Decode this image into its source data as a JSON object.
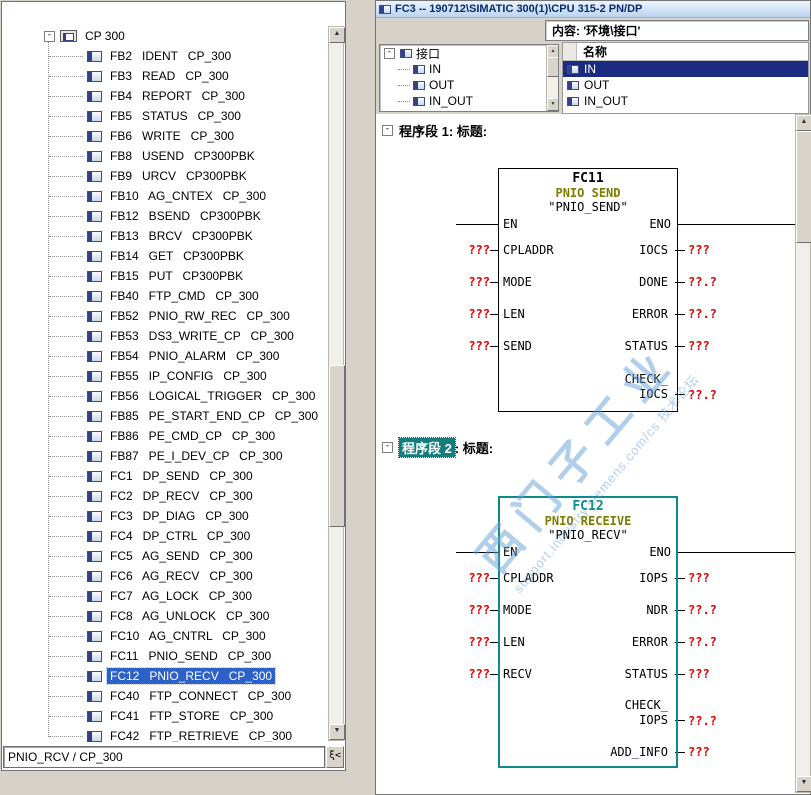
{
  "icons": {
    "minus": "-",
    "up": "▲",
    "down": "▼",
    "filter": "ξ<"
  },
  "left_panel": {
    "root_label": "CP 300",
    "items": [
      {
        "label": "FB2   IDENT   CP_300"
      },
      {
        "label": "FB3   READ   CP_300"
      },
      {
        "label": "FB4   REPORT   CP_300"
      },
      {
        "label": "FB5   STATUS   CP_300"
      },
      {
        "label": "FB6   WRITE   CP_300"
      },
      {
        "label": "FB8   USEND   CP300PBK"
      },
      {
        "label": "FB9   URCV   CP300PBK"
      },
      {
        "label": "FB10   AG_CNTEX   CP_300"
      },
      {
        "label": "FB12   BSEND   CP300PBK"
      },
      {
        "label": "FB13   BRCV   CP300PBK"
      },
      {
        "label": "FB14   GET   CP300PBK"
      },
      {
        "label": "FB15   PUT   CP300PBK"
      },
      {
        "label": "FB40   FTP_CMD   CP_300"
      },
      {
        "label": "FB52   PNIO_RW_REC   CP_300"
      },
      {
        "label": "FB53   DS3_WRITE_CP   CP_300"
      },
      {
        "label": "FB54   PNIO_ALARM   CP_300"
      },
      {
        "label": "FB55   IP_CONFIG   CP_300"
      },
      {
        "label": "FB56   LOGICAL_TRIGGER   CP_300"
      },
      {
        "label": "FB85   PE_START_END_CP   CP_300"
      },
      {
        "label": "FB86   PE_CMD_CP   CP_300"
      },
      {
        "label": "FB87   PE_I_DEV_CP   CP_300"
      },
      {
        "label": "FC1   DP_SEND   CP_300"
      },
      {
        "label": "FC2   DP_RECV   CP_300"
      },
      {
        "label": "FC3   DP_DIAG   CP_300"
      },
      {
        "label": "FC4   DP_CTRL   CP_300"
      },
      {
        "label": "FC5   AG_SEND   CP_300"
      },
      {
        "label": "FC6   AG_RECV   CP_300"
      },
      {
        "label": "FC7   AG_LOCK   CP_300"
      },
      {
        "label": "FC8   AG_UNLOCK   CP_300"
      },
      {
        "label": "FC10   AG_CNTRL   CP_300"
      },
      {
        "label": "FC11   PNIO_SEND   CP_300"
      },
      {
        "label": "FC12   PNIO_RECV   CP_300",
        "cls": "selected"
      },
      {
        "label": "FC40   FTP_CONNECT   CP_300"
      },
      {
        "label": "FC41   FTP_STORE   CP_300"
      },
      {
        "label": "FC42   FTP_RETRIEVE   CP_300"
      }
    ],
    "status_text": "PNIO_RCV / CP_300"
  },
  "right_panel": {
    "title": "FC3 -- 190712\\SIMATIC 300(1)\\CPU 315-2 PN/DP",
    "contents_label": "内容:  '环境\\接口'",
    "interface": {
      "root": "接口",
      "children": [
        {
          "label": "IN"
        },
        {
          "label": "OUT"
        },
        {
          "label": "IN_OUT"
        }
      ]
    },
    "table": {
      "header": "名称",
      "rows": [
        {
          "label": "IN",
          "cls": "selected"
        },
        {
          "label": "OUT"
        },
        {
          "label": "IN_OUT"
        }
      ]
    },
    "networks": [
      {
        "number_label": "程序段 1",
        "title_label": ": 标题:",
        "block": {
          "name": "FC11",
          "type": "PNIO SEND",
          "symbol": "\"PNIO_SEND\"",
          "rows": [
            {
              "l": "EN",
              "r": "ENO",
              "cls": "row-en"
            },
            {
              "l": "CPLADDR",
              "r": "IOCS",
              "lv": "???",
              "rv": "???",
              "cls": "row"
            },
            {
              "l": "MODE",
              "r": "DONE",
              "lv": "???",
              "rv": "??.?",
              "cls": "row"
            },
            {
              "l": "LEN",
              "r": "ERROR",
              "lv": "???",
              "rv": "??.?",
              "cls": "row"
            },
            {
              "l": "SEND",
              "r": "STATUS",
              "lv": "???",
              "rv": "???",
              "cls": "row"
            },
            {
              "l": "",
              "r": "CHECK_\nIOCS",
              "lv": "",
              "rv": "??.?",
              "cls": "row-tall no-l"
            }
          ]
        }
      },
      {
        "number_label": "程序段 2",
        "title_label": ": 标题:",
        "block": {
          "name": "FC12",
          "type": "PNIO RECEIVE",
          "symbol": "\"PNIO_RECV\"",
          "rows": [
            {
              "l": "EN",
              "r": "ENO",
              "cls": "row-en"
            },
            {
              "l": "CPLADDR",
              "r": "IOPS",
              "lv": "???",
              "rv": "???",
              "cls": "row"
            },
            {
              "l": "MODE",
              "r": "NDR",
              "lv": "???",
              "rv": "??.?",
              "cls": "row"
            },
            {
              "l": "LEN",
              "r": "ERROR",
              "lv": "???",
              "rv": "??.?",
              "cls": "row"
            },
            {
              "l": "RECV",
              "r": "STATUS",
              "lv": "???",
              "rv": "???",
              "cls": "row"
            },
            {
              "l": "",
              "r": "CHECK_\nIOPS",
              "lv": "",
              "rv": "??.?",
              "cls": "row-tall no-l"
            },
            {
              "l": "",
              "r": "ADD_INFO",
              "lv": "",
              "rv": "???",
              "cls": "row no-l"
            }
          ]
        }
      }
    ],
    "watermark": {
      "line1": "西门子工业",
      "line2": "support.industry.siemens.com/cs  技术论坛"
    }
  }
}
